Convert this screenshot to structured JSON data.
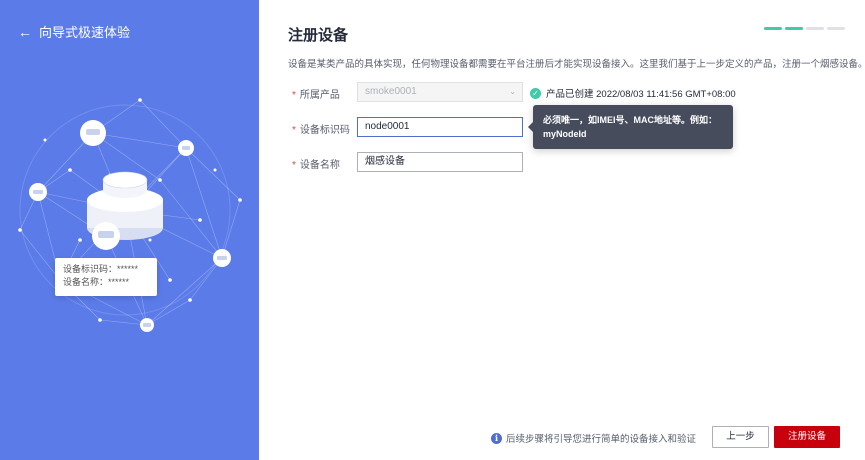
{
  "sidebar": {
    "back_label": "向导式极速体验",
    "card": {
      "id_label": "设备标识码：",
      "id_value": "******",
      "name_label": "设备名称：",
      "name_value": "******"
    }
  },
  "main": {
    "title": "注册设备",
    "steps_total": 4,
    "steps_done": 2,
    "description": "设备是某类产品的具体实现，任何物理设备都需要在平台注册后才能实现设备接入。这里我们基于上一步定义的产品，注册一个烟感设备。",
    "form": {
      "product": {
        "label": "所属产品",
        "value": "smoke0001",
        "status": "产品已创建 2022/08/03 11:41:56 GMT+08:00"
      },
      "node_id": {
        "label": "设备标识码",
        "value": "node0001"
      },
      "device_name": {
        "label": "设备名称",
        "value": "烟感设备"
      }
    },
    "tooltip": {
      "line1": "必须唯一，如IMEI号、MAC地址等。例如：",
      "line2": "myNodeId"
    },
    "footer": {
      "hint": "后续步骤将引导您进行简单的设备接入和验证",
      "prev_label": "上一步",
      "register_label": "注册设备"
    }
  },
  "colors": {
    "sidebar_bg": "#5b7be8",
    "primary_button": "#c7000b",
    "step_active": "#3dcca6"
  }
}
